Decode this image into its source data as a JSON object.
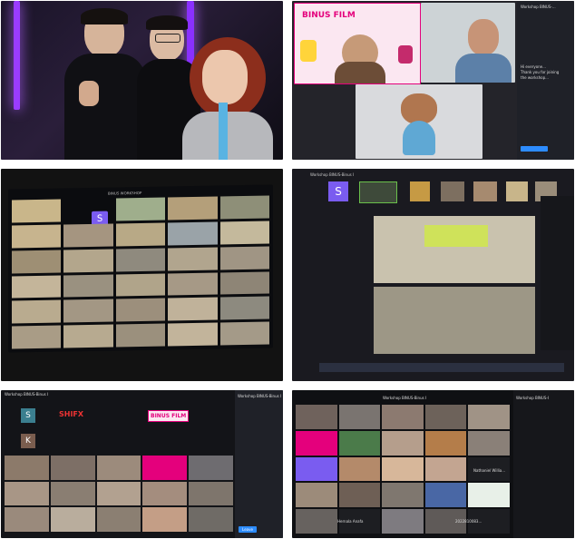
{
  "tiles": {
    "zoom_top": {
      "logo_text": "BINUS FILM",
      "chat_title": "Workshop BINUS-...",
      "chat_lines": [
        "Hi everyone...",
        "Thank you for joining",
        "the workshop..."
      ]
    },
    "laptop_left": {
      "banner": "BINUS WORKSHOP",
      "name_badge": "S",
      "footer": ""
    },
    "laptop_right": {
      "window_title": "Workshop BINUS-Binus I",
      "badge": "S"
    },
    "gallery_left": {
      "title": "Workshop BINUS-Binus I",
      "logo_text": "BINUS FILM",
      "badges": [
        "S",
        "K"
      ],
      "brand": "SHIFX",
      "chat_title": "Workshop BINUS-Binus I",
      "leave_label": "Leave"
    },
    "gallery_right": {
      "title": "Workshop BINUS-Binus I",
      "chat_title": "Workshop BINUS-I",
      "labels": [
        "Nathaniel Willia...",
        "Hernala Anafa",
        "2022810083..."
      ]
    }
  },
  "colors": {
    "neon_purple": "#9a3cff",
    "zoom_blue": "#2d8cff",
    "binus_pink": "#e4007c",
    "panel_dark": "#1f2128"
  }
}
